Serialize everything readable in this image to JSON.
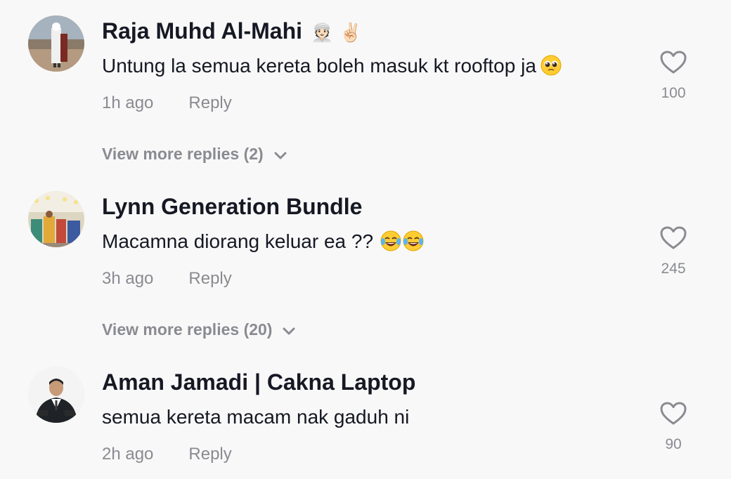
{
  "comments": [
    {
      "username": "Raja Muhd Al-Mahi",
      "username_emoji": "👳🏻 ✌🏻",
      "text": "Untung la semua kereta boleh masuk kt rooftop ja",
      "text_emoji_icon": "pleading-face-icon",
      "time": "1h ago",
      "reply_label": "Reply",
      "likes": "100",
      "more_replies": "View more replies (2)"
    },
    {
      "username": "Lynn Generation Bundle",
      "text": "Macamna diorang keluar ea ??",
      "text_emoji_icon": "tears-of-joy-icon",
      "time": "3h ago",
      "reply_label": "Reply",
      "likes": "245",
      "more_replies": "View more replies (20)"
    },
    {
      "username": "Aman Jamadi | Cakna Laptop",
      "text": "semua kereta macam nak gaduh ni",
      "time": "2h ago",
      "reply_label": "Reply",
      "likes": "90"
    }
  ],
  "colors": {
    "background": "#f8f8f8",
    "primary_text": "#161823",
    "secondary_text": "#8a8b91"
  }
}
